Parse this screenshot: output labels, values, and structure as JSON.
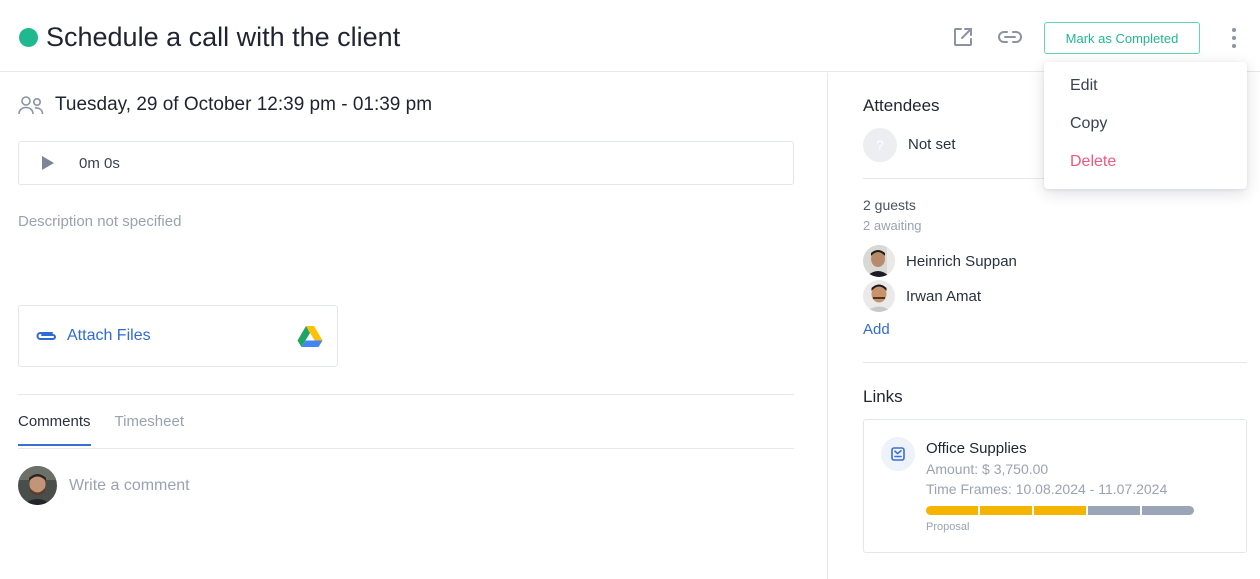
{
  "header": {
    "title": "Schedule a call with the client",
    "status_color": "#20b98f",
    "icons": [
      "open-external-icon",
      "link-icon"
    ],
    "complete_label": "Mark as Completed"
  },
  "menu": {
    "items": [
      {
        "label": "Edit"
      },
      {
        "label": "Copy"
      },
      {
        "label": "Delete",
        "color": "#f0577f"
      }
    ]
  },
  "event": {
    "datetime": "Tuesday, 29 of October 12:39 pm - 01:39 pm",
    "recording_time": "0m 0s",
    "description": "Description not specified",
    "attach_label": "Attach Files"
  },
  "tabs": [
    {
      "label": "Comments",
      "active": true
    },
    {
      "label": "Timesheet",
      "active": false
    }
  ],
  "comment": {
    "placeholder": "Write a comment"
  },
  "attendees": {
    "heading": "Attendees",
    "unset_label": "Not set",
    "unset_glyph": "?",
    "guests_count": "2 guests",
    "awaiting": "2 awaiting",
    "guests": [
      {
        "name": "Heinrich Suppan"
      },
      {
        "name": "Irwan Amat"
      }
    ],
    "add_label": "Add"
  },
  "links": {
    "heading": "Links",
    "items": [
      {
        "title": "Office Supplies",
        "amount": "Amount: $ 3,750.00",
        "time_frames": "Time Frames: 10.08.2024 - 11.07.2024",
        "stage_label": "Proposal",
        "stages_total": 5,
        "stages_done": 3,
        "stage_done_color": "#f5b400",
        "stage_todo_color": "#9aa5b8"
      }
    ]
  }
}
